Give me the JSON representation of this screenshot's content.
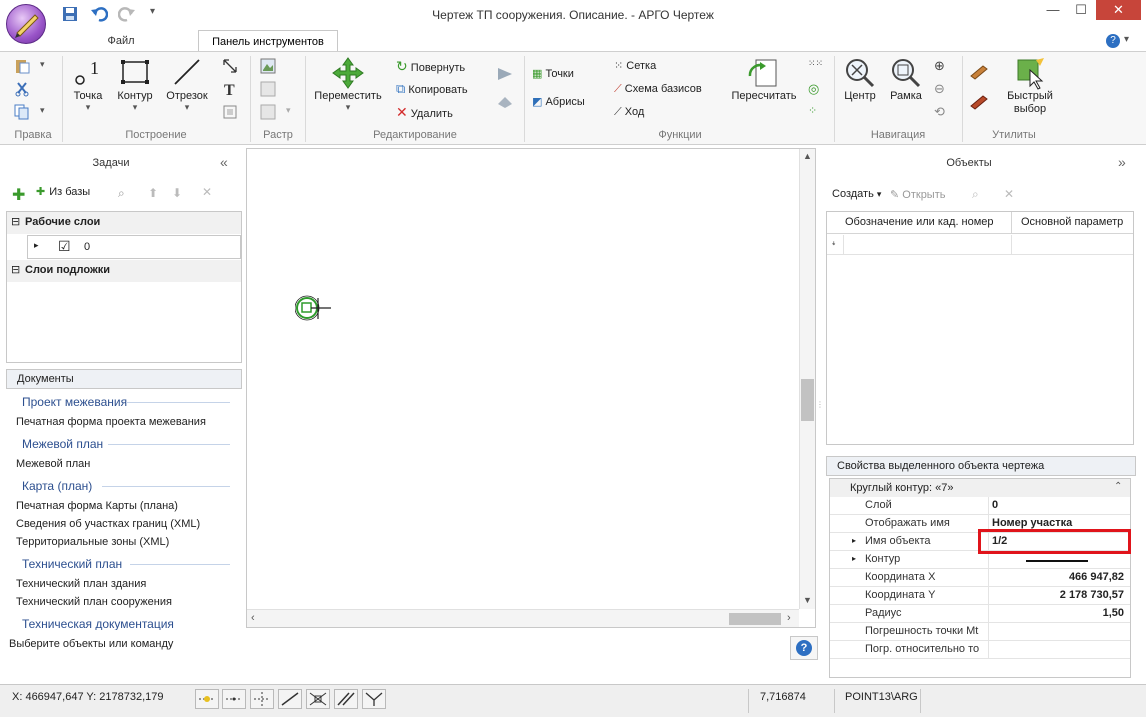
{
  "window": {
    "title": "Чертеж ТП сооружения. Описание. - АРГО Чертеж"
  },
  "tabs": [
    "Файл",
    "Панель инструментов"
  ],
  "ribbon": {
    "groups": [
      "Правка",
      "Построение",
      "Растр",
      "Редактирование",
      "Функции",
      "Навигация",
      "Утилиты"
    ],
    "build": {
      "point": "Точка",
      "contour": "Контур",
      "segment": "Отрезок"
    },
    "edit": {
      "move": "Переместить",
      "rotate": "Повернуть",
      "copy": "Копировать",
      "delete": "Удалить"
    },
    "functions": {
      "points": "Точки",
      "abrisy": "Абрисы",
      "grid": "Сетка",
      "scheme": "Схема базисов",
      "traverse": "Ход",
      "recalc": "Пересчитать"
    },
    "navigation": {
      "center": "Центр",
      "frame": "Рамка"
    },
    "utilities": {
      "quick_select": "Быстрый выбор"
    }
  },
  "tasks": {
    "title": "Задачи",
    "from_base": "Из базы",
    "working_layers": "Рабочие слои",
    "layer_name": "0",
    "underlay_layers": "Слои подложки"
  },
  "documents": {
    "title": "Документы",
    "groups": [
      {
        "heading": "Проект межевания",
        "items": [
          "Печатная форма проекта межевания"
        ]
      },
      {
        "heading": "Межевой план",
        "items": [
          "Межевой план"
        ]
      },
      {
        "heading": "Карта (план)",
        "items": [
          "Печатная форма Карты (плана)",
          "Сведения об участках границ (XML)",
          "Территориальные зоны (XML)"
        ]
      },
      {
        "heading": "Технический план",
        "items": [
          "Технический план здания",
          "Технический план сооружения"
        ]
      },
      {
        "heading": "Техническая документация",
        "items": []
      }
    ]
  },
  "objects": {
    "title": "Объекты",
    "create": "Создать",
    "open": "Открыть",
    "columns": [
      "Обозначение или кад. номер",
      "Основной параметр"
    ]
  },
  "properties": {
    "title": "Свойства выделенного объекта чертежа",
    "object_header": "Круглый контур: «7»",
    "rows": [
      {
        "name": "Слой",
        "value": "0"
      },
      {
        "name": "Отображать имя",
        "value": "Номер участка"
      },
      {
        "name": "Имя объекта",
        "value": "1/2"
      },
      {
        "name": "Контур",
        "value": ""
      },
      {
        "name": "Координата X",
        "value": "466 947,82"
      },
      {
        "name": "Координата Y",
        "value": "2 178 730,57"
      },
      {
        "name": "Радиус",
        "value": "1,50"
      },
      {
        "name": "Погрешность точки Mt",
        "value": ""
      },
      {
        "name": "Погр. относительно то",
        "value": ""
      }
    ]
  },
  "command_prompt": "Выберите объекты или команду",
  "statusbar": {
    "coords": "X: 466947,647 Y: 2178732,179",
    "scale": "7,716874",
    "snap_point": "POINT13\\ARG"
  },
  "colors": {
    "highlight_box": "#e0141b",
    "heading_blue": "#2c4f8f",
    "close_red": "#c7453a"
  }
}
